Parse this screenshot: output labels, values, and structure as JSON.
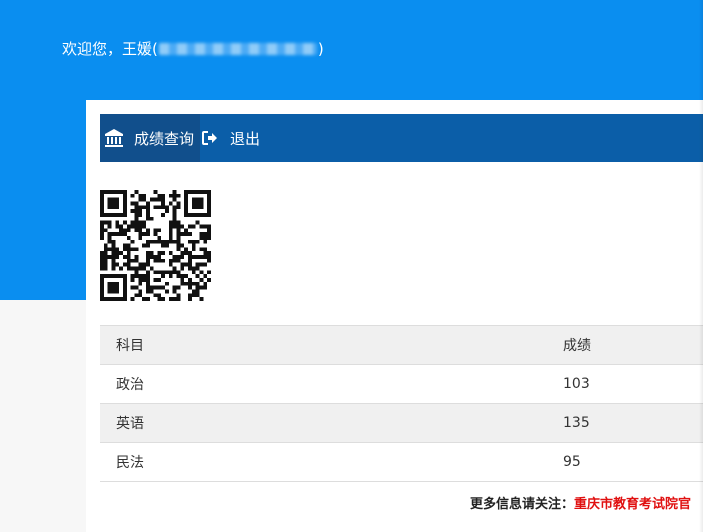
{
  "header": {
    "greeting_prefix": "欢迎您，王媛(",
    "greeting_suffix": ")"
  },
  "nav": {
    "scores_label": "成绩查询",
    "logout_label": "退出"
  },
  "table": {
    "headers": [
      "科目",
      "成绩"
    ],
    "rows": [
      [
        "政治",
        "103"
      ],
      [
        "英语",
        "135"
      ],
      [
        "民法",
        "95"
      ]
    ]
  },
  "footer": {
    "prefix": "更多信息请关注：",
    "link": "重庆市教育考试院官"
  },
  "colors": {
    "header_bg": "#0a8ef0",
    "navbar_bg": "#0b5ea8",
    "link_red": "#e01010"
  },
  "icons": {
    "scores": "bank-icon",
    "logout": "logout-icon"
  }
}
